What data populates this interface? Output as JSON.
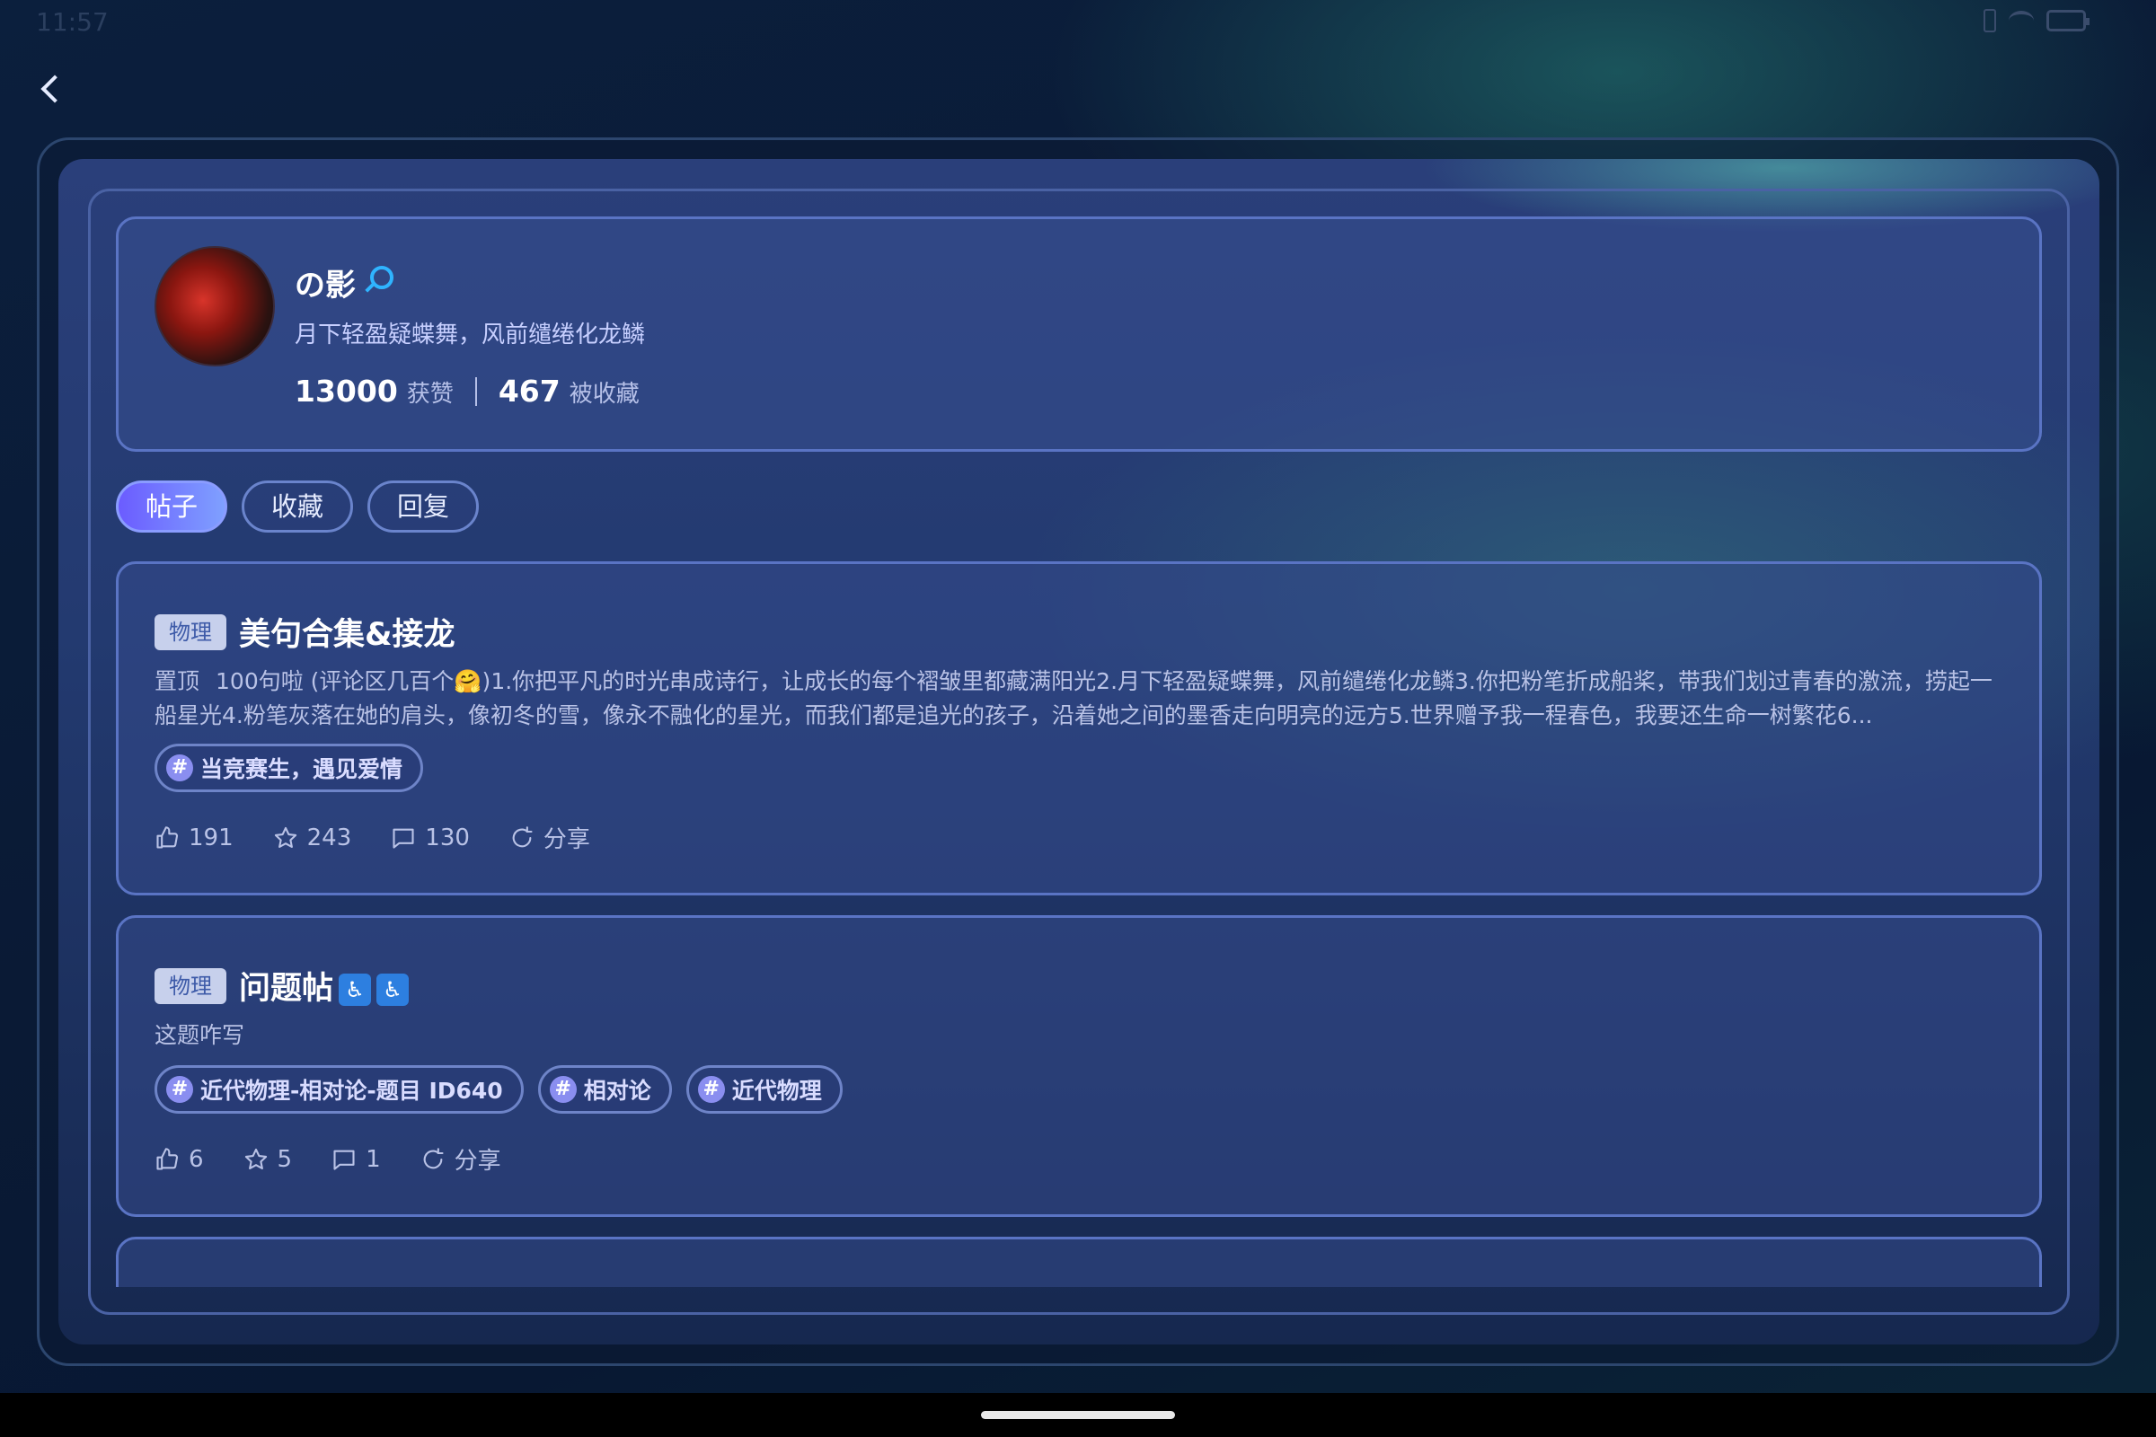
{
  "status_bar": {
    "time": "11:57"
  },
  "profile": {
    "username": "の影",
    "bio": "月下轻盈疑蝶舞，风前缱绻化龙鳞",
    "likes_count": "13000",
    "likes_label": "获赞",
    "favorites_count": "467",
    "favorites_label": "被收藏"
  },
  "tabs": [
    {
      "label": "帖子",
      "active": true
    },
    {
      "label": "收藏",
      "active": false
    },
    {
      "label": "回复",
      "active": false
    }
  ],
  "posts": [
    {
      "category": "物理",
      "title": "美句合集&接龙",
      "pinned_label": "置顶",
      "body": "100句啦 (评论区几百个🤗)1.你把平凡的时光串成诗行，让成长的每个褶皱里都藏满阳光2.月下轻盈疑蝶舞，风前缱绻化龙鳞3.你把粉笔折成船桨，带我们划过青春的激流，捞起一船星光4.粉笔灰落在她的肩头，像初冬的雪，像永不融化的星光，而我们都是追光的孩子，沿着她之间的墨香走向明亮的远方5.世界赠予我一程春色，我要还生命一树繁花6...",
      "tags": [
        "当竞赛生，遇见爱情"
      ],
      "likes": "191",
      "stars": "243",
      "comments": "130",
      "share_label": "分享"
    },
    {
      "category": "物理",
      "title": "问题帖",
      "title_emoji": "♿",
      "body": "这题咋写",
      "tags": [
        "近代物理-相对论-题目 ID640",
        "相对论",
        "近代物理"
      ],
      "likes": "6",
      "stars": "5",
      "comments": "1",
      "share_label": "分享"
    }
  ]
}
